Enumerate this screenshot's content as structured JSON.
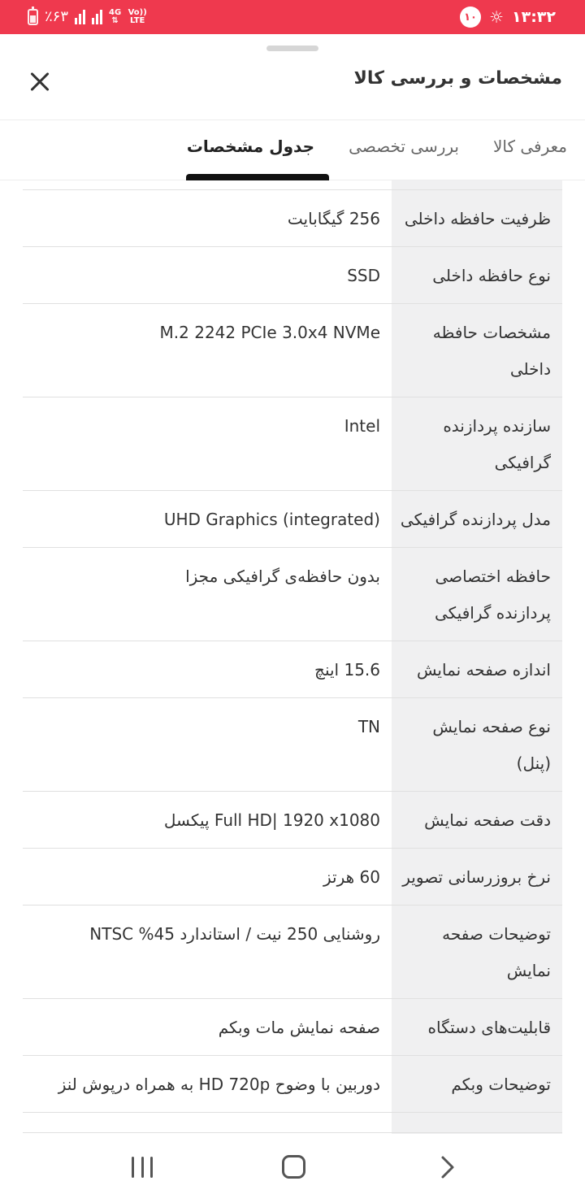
{
  "status_bar": {
    "battery": "٪۶۳",
    "network": "4G",
    "volte": "Vo)) LTE",
    "notification_count": "۱۰",
    "time": "۱۳:۳۲",
    "background_color": "#ef394e"
  },
  "sheet": {
    "title": "مشخصات و بررسی کالا",
    "close_icon": "close-icon"
  },
  "tabs": [
    {
      "label": "معرفی کالا",
      "active": false
    },
    {
      "label": "بررسی تخصصی",
      "active": false
    },
    {
      "label": "جدول مشخصات",
      "active": true
    }
  ],
  "specs": [
    {
      "key": "ظرفیت حافظه داخلی",
      "value": "256 گیگابایت"
    },
    {
      "key": "نوع حافظه داخلی",
      "value": "SSD"
    },
    {
      "key": "مشخصات حافظه داخلی",
      "value": "M.2 2242 PCIe 3.0x4 NVMe"
    },
    {
      "key": "سازنده پردازنده گرافیکی",
      "value": "Intel"
    },
    {
      "key": "مدل پردازنده گرافیکی",
      "value": "UHD Graphics (integrated)"
    },
    {
      "key": "حافظه اختصاصی پردازنده گرافیکی",
      "value": "بدون حافظه‌ی گرافیکی مجزا"
    },
    {
      "key": "اندازه صفحه نمایش",
      "value": "15.6 اینچ"
    },
    {
      "key": "نوع صفحه نمایش (پنل)",
      "value": "TN"
    },
    {
      "key": "دقت صفحه نمایش",
      "value": "Full HD| 1920 x1080 پیکسل"
    },
    {
      "key": "نرخ بروزرسانی تصویر",
      "value": "60 هرتز"
    },
    {
      "key": "توضیحات صفحه نمایش",
      "value": "روشنایی 250 نیت / استاندارد 45% NTSC"
    },
    {
      "key": "قابلیت‌های دستگاه",
      "value": "صفحه نمایش مات وبکم"
    },
    {
      "key": "توضیحات وبکم",
      "value": "دوربین با وضوح HD 720p به همراه درپوش لنز"
    },
    {
      "key": "",
      "value": ""
    }
  ],
  "nav_bar": {
    "recent_icon": "recent-apps-icon",
    "home_icon": "home-icon",
    "back_icon": "back-chevron-icon"
  }
}
